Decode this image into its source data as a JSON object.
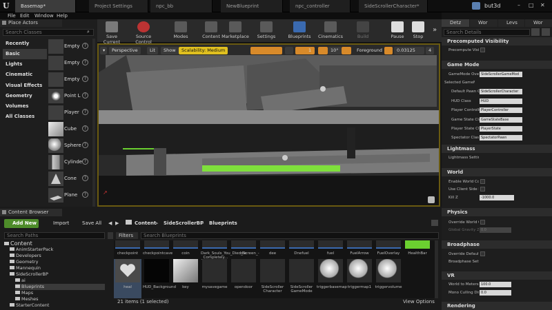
{
  "doc_tabs": [
    "Basemap*",
    "Project Settings",
    "npc_bb",
    "NewBlueprint",
    "npc_controller",
    "SideScrollerCharacter*"
  ],
  "user": "but3d",
  "menu": [
    "File",
    "Edit",
    "Window",
    "Help"
  ],
  "place_actors": {
    "tab": "Place Actors",
    "search_placeholder": "Search Classes",
    "categories": [
      "Recently Placed",
      "Basic",
      "Lights",
      "Cinematic",
      "Visual Effects",
      "Geometry",
      "Volumes",
      "All Classes"
    ],
    "actors": [
      "Empty",
      "Empty",
      "Empty",
      "Point L",
      "Player",
      "Cube",
      "Sphere",
      "Cylinde",
      "Cone",
      "Plane"
    ]
  },
  "toolbar": [
    "Save Current",
    "Source Control",
    "Modes",
    "Content",
    "Marketplace",
    "Settings",
    "Blueprints",
    "Cinematics",
    "Build",
    "Pause",
    "Stop"
  ],
  "viewport": {
    "perspective": "Perspective",
    "lit": "Lit",
    "show": "Show",
    "scalability": "Scalability: Medium",
    "snap_num": "1",
    "rot": "10°",
    "layer": "Foreground",
    "scale": "0.03125",
    "cam": "4"
  },
  "details": {
    "tabs": [
      "Detz",
      "Wor",
      "Levs",
      "Wor"
    ],
    "search_placeholder": "Search Details",
    "sections": [
      {
        "title": "Precomputed Visibility",
        "rows": [
          {
            "label": "Precompute Visibi",
            "type": "check"
          }
        ]
      },
      {
        "title": "Game Mode",
        "rows": [
          {
            "label": "GameMode Overr",
            "value": "SideScrollerGameMod"
          },
          {
            "label": "Selected GameM",
            "value": ""
          },
          {
            "label": "Default Pawn C",
            "value": "SideScrollerCharacter"
          },
          {
            "label": "HUD Class",
            "value": "HUD"
          },
          {
            "label": "Player Controlle",
            "value": "PlayerController"
          },
          {
            "label": "Game State Cla",
            "value": "GameStateBase"
          },
          {
            "label": "Player State Cl",
            "value": "PlayerState"
          },
          {
            "label": "Spectator Clas",
            "value": "SpectatorPawn"
          }
        ]
      },
      {
        "title": "Lightmass",
        "rows": [
          {
            "label": "Lightmass Setting",
            "value": ""
          }
        ]
      },
      {
        "title": "World",
        "rows": [
          {
            "label": "Enable World Com",
            "type": "check"
          },
          {
            "label": "Use Client Side Le",
            "type": "check"
          },
          {
            "label": "Kill Z",
            "value": "-1000.0"
          }
        ]
      },
      {
        "title": "Physics",
        "rows": [
          {
            "label": "Override World Gr",
            "type": "check"
          },
          {
            "label": "Global Gravity Z",
            "value": "0.0"
          }
        ]
      },
      {
        "title": "Broadphase",
        "rows": [
          {
            "label": "Override Default E",
            "type": "check"
          },
          {
            "label": "Broadphase Setti",
            "value": ""
          }
        ]
      },
      {
        "title": "VR",
        "rows": [
          {
            "label": "World to Meters",
            "value": "100.0"
          },
          {
            "label": "Mono Culling Dist",
            "value": "0.0"
          }
        ]
      },
      {
        "title": "Rendering",
        "rows": []
      }
    ]
  },
  "content_browser": {
    "tab": "Content Browser",
    "add_new": "Add New",
    "import": "Import",
    "save_all": "Save All",
    "breadcrumb": [
      "Content",
      "SideScrollerBP",
      "Blueprints"
    ],
    "search_paths": "Search Paths",
    "filters": "Filters",
    "search_bp": "Search Blueprints",
    "tree": [
      {
        "label": "Content",
        "level": 0
      },
      {
        "label": "AnimStarterPack",
        "level": 1
      },
      {
        "label": "Developers",
        "level": 1
      },
      {
        "label": "Geometry",
        "level": 1
      },
      {
        "label": "Mannequin",
        "level": 1
      },
      {
        "label": "SideScrollerBP",
        "level": 1
      },
      {
        "label": "ai",
        "level": 2
      },
      {
        "label": "Blueprints",
        "level": 2,
        "selected": true
      },
      {
        "label": "Maps",
        "level": 2
      },
      {
        "label": "Meshes",
        "level": 2
      },
      {
        "label": "StarterContent",
        "level": 1
      }
    ],
    "assets_row1": [
      "checkpoint",
      "checkpointcave",
      "coin",
      "Dark_Souls_You_Died_Screen_-_Completely...",
      "die",
      "dee",
      "Dnefuel",
      "fuel",
      "FuelArrow",
      "FuelOverlay",
      "HealthBar"
    ],
    "assets_row2": [
      "heal",
      "HUD_Background",
      "key",
      "mysavegame",
      "opendoor",
      "SideScroller Character",
      "SideScroller GameMode",
      "triggerbasemap",
      "triggermap1",
      "triggervolume"
    ],
    "status": "21 items (1 selected)",
    "view_options": "View Options"
  }
}
